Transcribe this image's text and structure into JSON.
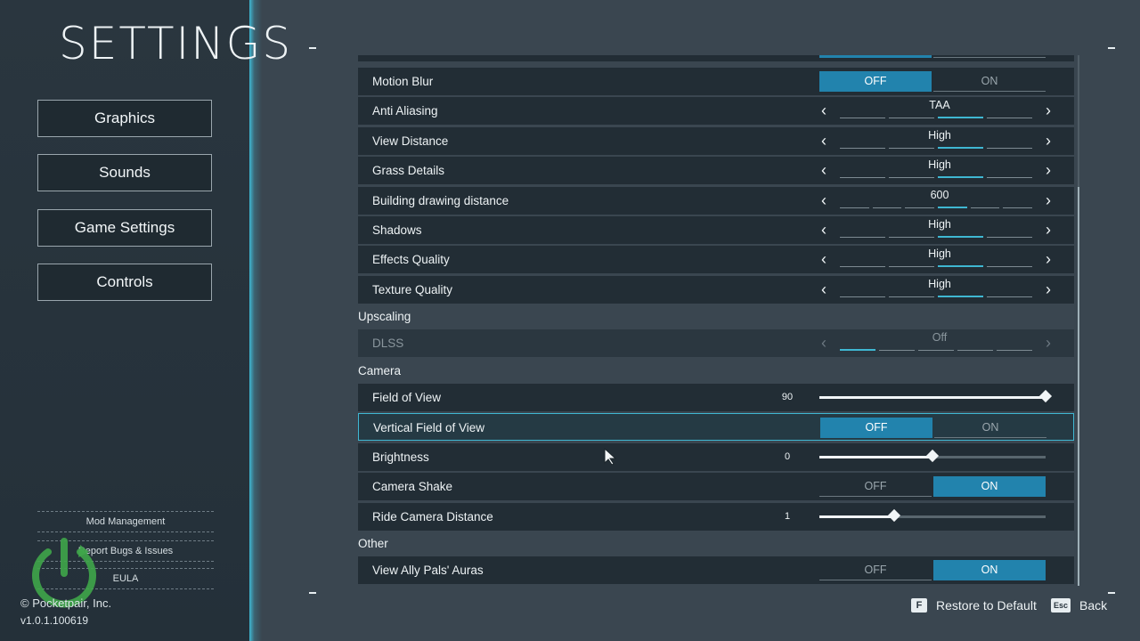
{
  "title": "SETTINGS",
  "nav": [
    {
      "label": "Graphics"
    },
    {
      "label": "Sounds"
    },
    {
      "label": "Game Settings"
    },
    {
      "label": "Controls"
    }
  ],
  "links": [
    {
      "label": "Mod Management"
    },
    {
      "label": "Report Bugs & Issues"
    },
    {
      "label": "EULA"
    }
  ],
  "copyright": "© Pocketpair, Inc.",
  "version": "v1.0.1.100619",
  "toggle_labels": {
    "off": "OFF",
    "on": "ON"
  },
  "dlss_toggle": {
    "off": "Off"
  },
  "graphics_rows": [
    {
      "label": "Motion Blur",
      "type": "toggle",
      "value": "OFF"
    },
    {
      "label": "Anti Aliasing",
      "type": "selector",
      "value": "TAA"
    },
    {
      "label": "View Distance",
      "type": "selector",
      "value": "High"
    },
    {
      "label": "Grass Details",
      "type": "selector",
      "value": "High"
    },
    {
      "label": "Building drawing distance",
      "type": "selector",
      "value": "600"
    },
    {
      "label": "Shadows",
      "type": "selector",
      "value": "High"
    },
    {
      "label": "Effects Quality",
      "type": "selector",
      "value": "High"
    },
    {
      "label": "Texture Quality",
      "type": "selector",
      "value": "High"
    }
  ],
  "upscaling": {
    "title": "Upscaling",
    "rows": [
      {
        "label": "DLSS",
        "type": "selector",
        "value": "Off",
        "disabled": true
      }
    ]
  },
  "camera": {
    "title": "Camera",
    "rows": [
      {
        "label": "Field of View",
        "type": "slider",
        "value": "90",
        "fraction": 1.0
      },
      {
        "label": "Vertical Field of View",
        "type": "toggle",
        "value": "OFF",
        "selected": true
      },
      {
        "label": "Brightness",
        "type": "slider",
        "value": "0",
        "fraction": 0.5
      },
      {
        "label": "Camera Shake",
        "type": "toggle",
        "value": "ON"
      },
      {
        "label": "Ride Camera Distance",
        "type": "slider",
        "value": "1",
        "fraction": 0.33
      }
    ]
  },
  "other": {
    "title": "Other",
    "rows": [
      {
        "label": "View Ally Pals' Auras",
        "type": "toggle",
        "value": "ON"
      }
    ]
  },
  "footer": {
    "restore_key": "F",
    "restore_label": "Restore to Default",
    "back_key": "Esc",
    "back_label": "Back"
  },
  "colors": {
    "accent": "#2283ad",
    "highlight": "#3fb7d2",
    "row_bg": "#222d35"
  },
  "icons": [
    "power-icon",
    "chevron-left-icon",
    "chevron-right-icon",
    "mouse-cursor-icon"
  ]
}
